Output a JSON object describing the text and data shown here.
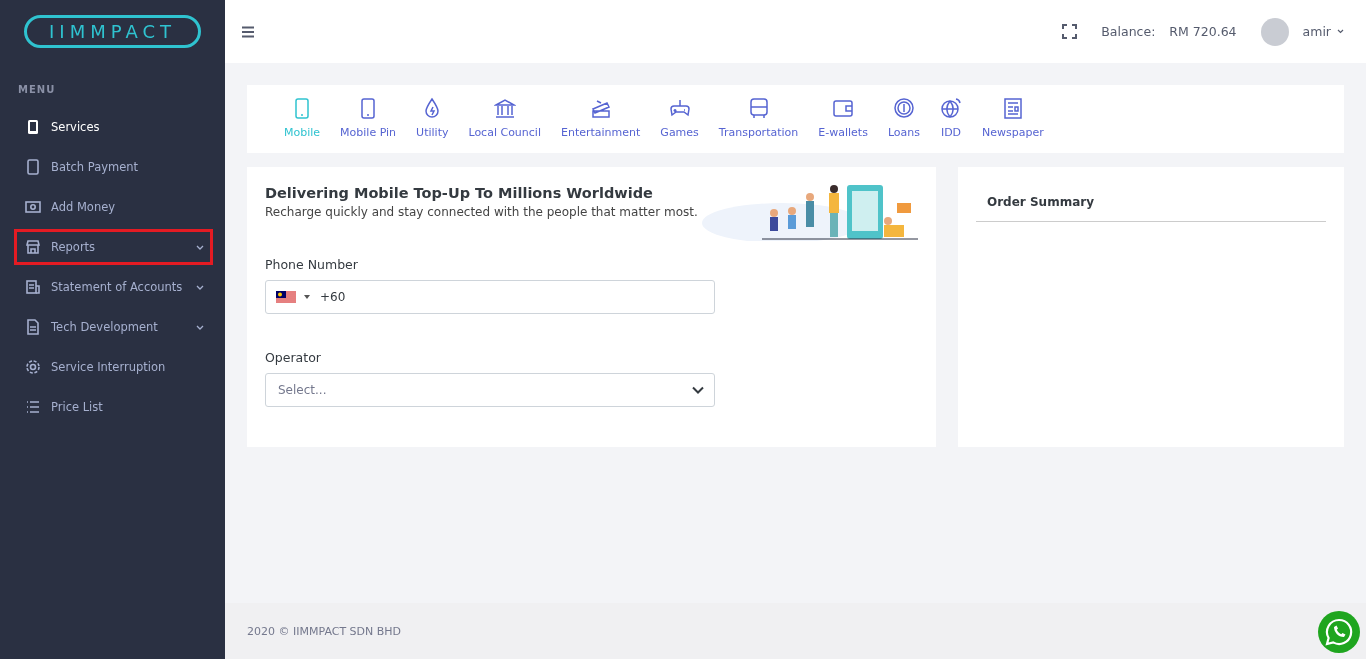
{
  "logo": "IIMMPACT",
  "sidebar": {
    "heading": "MENU",
    "items": [
      {
        "label": "Services",
        "selected": true,
        "expandable": false,
        "highlighted": false
      },
      {
        "label": "Batch Payment",
        "selected": false,
        "expandable": false,
        "highlighted": false
      },
      {
        "label": "Add Money",
        "selected": false,
        "expandable": false,
        "highlighted": false
      },
      {
        "label": "Reports",
        "selected": false,
        "expandable": true,
        "highlighted": true
      },
      {
        "label": "Statement of Accounts",
        "selected": false,
        "expandable": true,
        "highlighted": false
      },
      {
        "label": "Tech Development",
        "selected": false,
        "expandable": true,
        "highlighted": false
      },
      {
        "label": "Service Interruption",
        "selected": false,
        "expandable": false,
        "highlighted": false
      },
      {
        "label": "Price List",
        "selected": false,
        "expandable": false,
        "highlighted": false
      }
    ]
  },
  "header": {
    "balance_label": "Balance:",
    "balance": "RM 720.64",
    "user": "amir"
  },
  "categories": [
    {
      "label": "Mobile",
      "selected": true
    },
    {
      "label": "Mobile Pin",
      "selected": false
    },
    {
      "label": "Utility",
      "selected": false
    },
    {
      "label": "Local Council",
      "selected": false
    },
    {
      "label": "Entertainment",
      "selected": false
    },
    {
      "label": "Games",
      "selected": false
    },
    {
      "label": "Transportation",
      "selected": false
    },
    {
      "label": "E-wallets",
      "selected": false
    },
    {
      "label": "Loans",
      "selected": false
    },
    {
      "label": "IDD",
      "selected": false
    },
    {
      "label": "Newspaper",
      "selected": false
    }
  ],
  "form": {
    "title": "Delivering Mobile Top-Up To Millions Worldwide",
    "subtitle": "Recharge quickly and stay connected with the people that matter most.",
    "phone": {
      "label": "Phone Number",
      "value": "+60"
    },
    "operator": {
      "label": "Operator",
      "placeholder": "Select..."
    }
  },
  "order_summary": {
    "title": "Order Summary"
  },
  "footer": "2020 © IIMMPACT SDN BHD"
}
